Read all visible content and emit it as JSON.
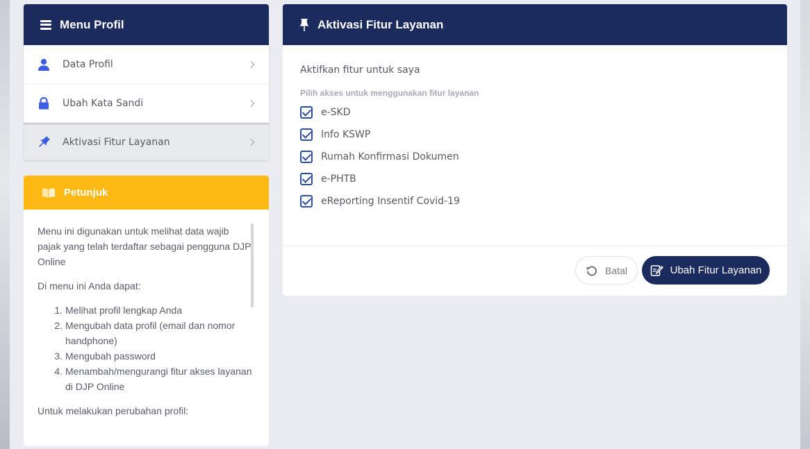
{
  "sidebar": {
    "title": "Menu Profil",
    "items": [
      {
        "label": "Data Profil",
        "icon": "user-icon"
      },
      {
        "label": "Ubah Kata Sandi",
        "icon": "lock-icon"
      },
      {
        "label": "Aktivasi Fitur Layanan",
        "icon": "pin-icon"
      }
    ],
    "active_index": 2
  },
  "petunjuk": {
    "title": "Petunjuk",
    "intro": "Menu ini digunakan untuk melihat data wajib pajak yang telah terdaftar sebagai pengguna DJP Online",
    "lead": "Di menu ini Anda dapat:",
    "steps": [
      "Melihat profil lengkap Anda",
      "Mengubah data profil (email dan nomor handphone)",
      "Mengubah password",
      "Menambah/mengurangi fitur akses layanan di DJP Online"
    ],
    "footer": "Untuk melakukan perubahan profil:"
  },
  "main": {
    "title": "Aktivasi Fitur Layanan",
    "section_title": "Aktifkan fitur untuk saya",
    "subtitle": "Pilih akses untuk menggunakan fitur layanan",
    "options": [
      {
        "label": "e-SKD",
        "checked": true
      },
      {
        "label": "Info KSWP",
        "checked": true
      },
      {
        "label": "Rumah Konfirmasi Dokumen",
        "checked": true
      },
      {
        "label": "e-PHTB",
        "checked": true
      },
      {
        "label": "eReporting Insentif Covid-19",
        "checked": true
      }
    ],
    "cancel_label": "Batal",
    "submit_label": "Ubah Fitur Layanan"
  },
  "colors": {
    "navy": "#1c2b5e",
    "amber": "#fdb813",
    "check": "#2d4ca3",
    "icon_blue": "#3d5ee1"
  }
}
